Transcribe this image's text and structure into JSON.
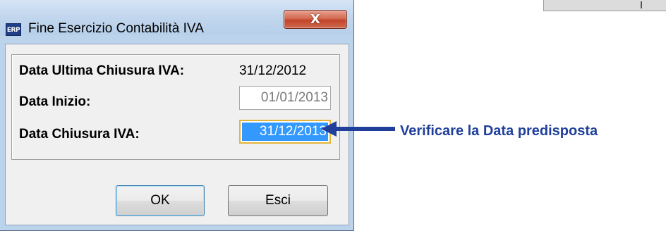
{
  "window": {
    "title": "Fine Esercizio Contabilità IVA",
    "app_icon_text": "ERP",
    "close_glyph": "X"
  },
  "form": {
    "last_close": {
      "label": "Data Ultima Chiusura IVA:",
      "value": "31/12/2012"
    },
    "start_date": {
      "label": "Data Inizio:",
      "value": "01/01/2013"
    },
    "close_date": {
      "label": "Data Chiusura IVA:",
      "value": "31/12/2013"
    }
  },
  "buttons": {
    "ok": "OK",
    "exit": "Esci"
  },
  "annotation": {
    "text": "Verificare la Data predisposta",
    "color": "#1f3f9a"
  },
  "colors": {
    "titlebar": "#bcd3ec",
    "close_button": "#c2432a",
    "selection": "#3399ff",
    "focus_border": "#e4b43a"
  }
}
